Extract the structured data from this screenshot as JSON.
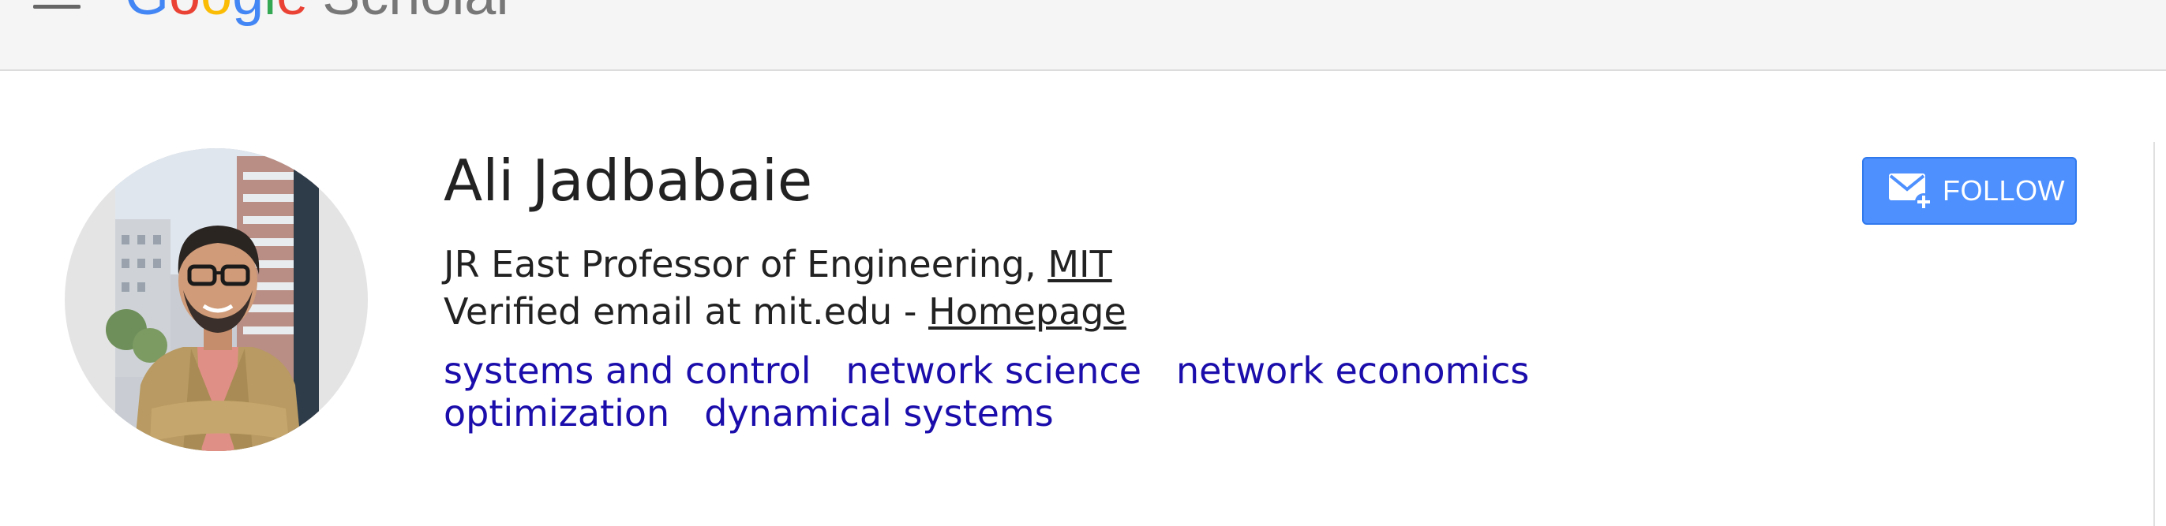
{
  "header": {
    "logo_google": [
      "G",
      "o",
      "o",
      "g",
      "l",
      "e"
    ],
    "logo_product": "Scholar"
  },
  "profile": {
    "name": "Ali Jadbabaie",
    "affiliation_prefix": "JR East Professor of Engineering, ",
    "affiliation_link": "MIT",
    "email_prefix": "Verified email at mit.edu - ",
    "homepage_link": "Homepage",
    "interests": [
      "systems and control",
      "network science",
      "network economics",
      "optimization",
      "dynamical systems"
    ]
  },
  "actions": {
    "follow_label": "FOLLOW",
    "follow_icon": "mail-plus-icon"
  },
  "colors": {
    "accent": "#4d90fe",
    "link": "#1a0dab",
    "text": "#222222"
  }
}
